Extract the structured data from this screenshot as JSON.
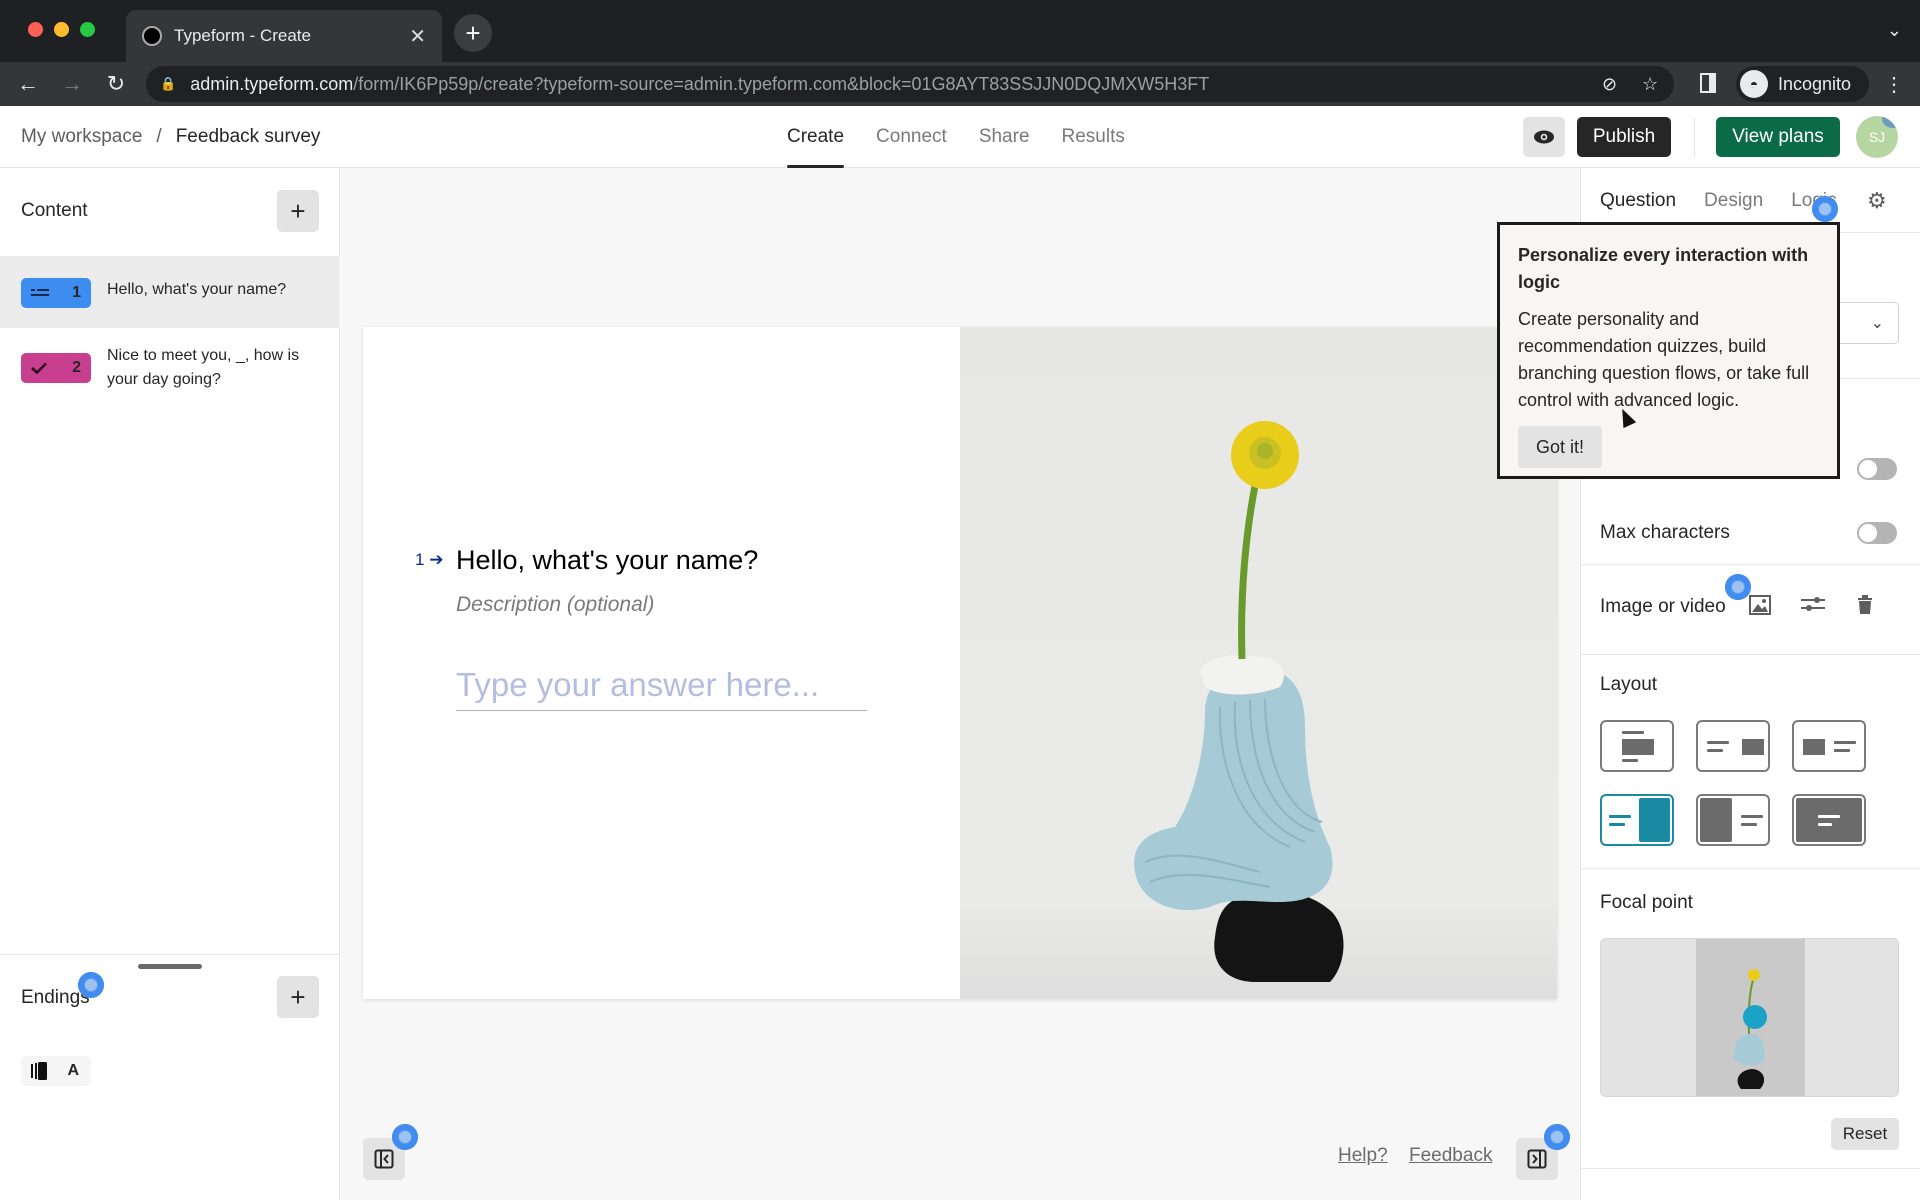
{
  "browser": {
    "tab_title": "Typeform - Create",
    "url_host": "admin.typeform.com",
    "url_path": "/form/IK6Pp59p/create?typeform-source=admin.typeform.com&block=01G8AYT83SSJJN0DQJMXW5H3FT",
    "profile_label": "Incognito"
  },
  "header": {
    "breadcrumb": [
      "My workspace",
      "/",
      "Feedback survey"
    ],
    "tabs": [
      {
        "label": "Create",
        "active": true
      },
      {
        "label": "Connect",
        "active": false
      },
      {
        "label": "Share",
        "active": false
      },
      {
        "label": "Results",
        "active": false
      }
    ],
    "publish_label": "Publish",
    "view_plans_label": "View plans",
    "avatar_initials": "SJ",
    "colors": {
      "publish": "#262627",
      "view_plans": "#0b6b46"
    }
  },
  "content_panel": {
    "title": "Content",
    "questions": [
      {
        "number": "1",
        "text": "Hello, what's your name?",
        "type_icon": "short-text-icon",
        "color": "#3d8cf0",
        "selected": true
      },
      {
        "number": "2",
        "text": "Nice to meet you, _, how is your day going?",
        "type_icon": "checkmark-icon",
        "color": "#c83f8f",
        "selected": false
      }
    ],
    "endings_title": "Endings",
    "ending_item": {
      "icon": "ending-screen-icon",
      "letter": "A"
    }
  },
  "canvas": {
    "question_number": "1",
    "question_title": "Hello, what's your name?",
    "description_placeholder": "Description (optional)",
    "answer_placeholder": "Type your answer here...",
    "help_link": "Help?",
    "feedback_link": "Feedback"
  },
  "settings_panel": {
    "tabs": [
      {
        "label": "Question",
        "active": true
      },
      {
        "label": "Design",
        "active": false
      },
      {
        "label": "Logic",
        "active": false
      }
    ],
    "max_characters_label": "Max characters",
    "max_characters_enabled": false,
    "hidden_toggle_enabled": false,
    "image_or_video_label": "Image or video",
    "layout_label": "Layout",
    "layout_selected_index": 3,
    "focal_point_label": "Focal point",
    "reset_label": "Reset",
    "accent": "#1a8aa3"
  },
  "popover": {
    "title": "Personalize every interaction with logic",
    "body": "Create personality and recommendation quizzes, build branching question flows, or take full control with advanced logic.",
    "button_label": "Got it!"
  }
}
